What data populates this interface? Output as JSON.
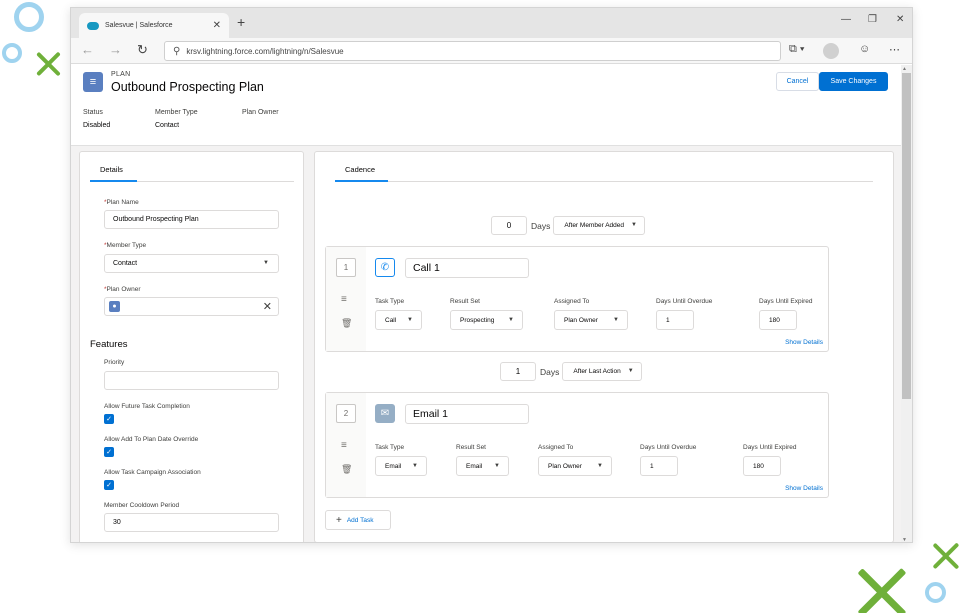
{
  "browser": {
    "tab_title": "Salesvue | Salesforce",
    "url": "krsv.lightning.force.com/lightning/n/Salesvue"
  },
  "header": {
    "object_label": "PLAN",
    "title": "Outbound Prospecting Plan",
    "cancel_label": "Cancel",
    "save_label": "Save Changes",
    "fields": [
      {
        "label": "Status",
        "value": "Disabled"
      },
      {
        "label": "Member Type",
        "value": "Contact"
      },
      {
        "label": "Plan Owner",
        "value": ""
      }
    ]
  },
  "details": {
    "tab_label": "Details",
    "plan_name_label": "Plan Name",
    "plan_name_value": "Outbound Prospecting Plan",
    "member_type_label": "Member Type",
    "member_type_value": "Contact",
    "plan_owner_label": "Plan Owner",
    "required_mark": "*",
    "features_title": "Features",
    "priority_label": "Priority",
    "priority_value": "",
    "allow_future_label": "Allow Future Task Completion",
    "allow_add_label": "Allow Add To Plan Date Override",
    "allow_campaign_label": "Allow Task Campaign Association",
    "cooldown_label": "Member Cooldown Period",
    "cooldown_value": "30"
  },
  "cadence": {
    "tab_label": "Cadence",
    "days_word": "Days",
    "initial_days": "0",
    "initial_trigger": "After Member Added",
    "between_days": "1",
    "between_trigger": "After Last Action",
    "add_task_label": "Add Task",
    "tasks": [
      {
        "number": "1",
        "name": "Call 1",
        "icon": "phone-icon",
        "icon_color": "#1589ee",
        "task_type_label": "Task Type",
        "task_type": "Call",
        "result_set_label": "Result Set",
        "result_set": "Prospecting",
        "assigned_to_label": "Assigned To",
        "assigned_to": "Plan Owner",
        "overdue_label": "Days Until Overdue",
        "overdue": "1",
        "expired_label": "Days Until Expired",
        "expired": "180",
        "show_details": "Show Details"
      },
      {
        "number": "2",
        "name": "Email 1",
        "icon": "envelope-icon",
        "icon_color": "#95aec5",
        "task_type_label": "Task Type",
        "task_type": "Email",
        "result_set_label": "Result Set",
        "result_set": "Email",
        "assigned_to_label": "Assigned To",
        "assigned_to": "Plan Owner",
        "overdue_label": "Days Until Overdue",
        "overdue": "1",
        "expired_label": "Days Until Expired",
        "expired": "180",
        "show_details": "Show Details"
      }
    ]
  },
  "colors": {
    "brand_blue": "#0070d2",
    "deco_green": "#6fb03a",
    "deco_ring": "#9fd3ef"
  }
}
